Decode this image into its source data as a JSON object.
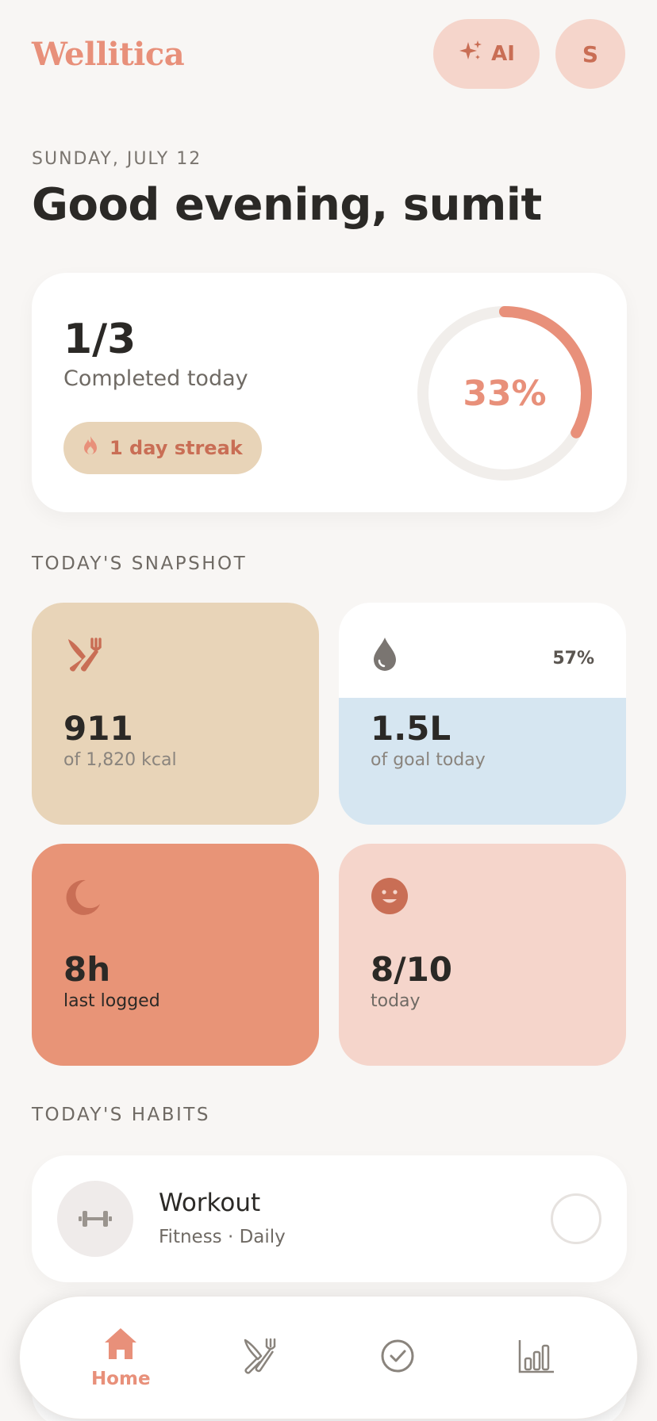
{
  "app": {
    "brand": "Wellitica",
    "ai_label": "AI",
    "avatar_initial": "S"
  },
  "header": {
    "date": "SUNDAY, JULY 12",
    "greeting": "Good evening, sumit"
  },
  "progress": {
    "count": "1/3",
    "label": "Completed today",
    "streak": "1 day streak",
    "percent_text": "33%",
    "percent": 0.33
  },
  "snapshot": {
    "title": "TODAY'S SNAPSHOT",
    "food": {
      "value": "911",
      "sub": "of 1,820 kcal",
      "icon": "utensils-icon"
    },
    "water": {
      "value": "1.5L",
      "sub": "of goal today",
      "percent_text": "57%",
      "fill": 0.57,
      "icon": "water-drop-icon"
    },
    "sleep": {
      "value": "8h",
      "sub": "last logged",
      "icon": "moon-icon"
    },
    "mood": {
      "value": "8/10",
      "sub": "today",
      "icon": "smile-icon"
    }
  },
  "habits": {
    "title": "TODAY'S HABITS",
    "items": [
      {
        "name": "Workout",
        "meta": "Fitness · Daily",
        "icon": "dumbbell-icon",
        "done": false
      }
    ]
  },
  "nav": {
    "home_label": "Home",
    "items": [
      "home-icon",
      "utensils-icon",
      "check-circle-icon",
      "bar-chart-icon"
    ]
  },
  "colors": {
    "accent": "#e8907a",
    "peach": "#f5d5cb",
    "sand": "#e8d4b8",
    "coral": "#e89477",
    "water": "#d6e6f1",
    "background": "#f8f6f4"
  }
}
